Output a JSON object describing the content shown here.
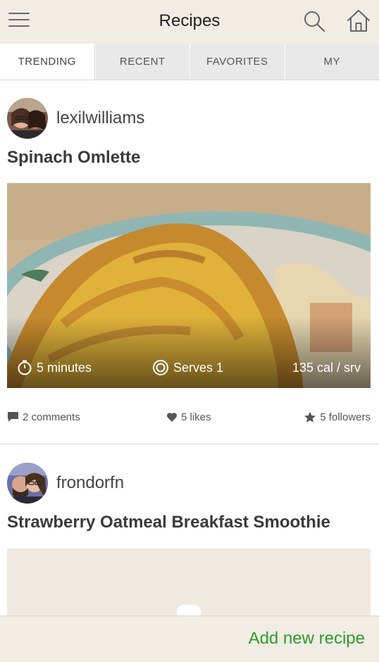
{
  "header": {
    "title": "Recipes",
    "menu_icon": "hamburger-menu-icon",
    "search_icon": "search-icon",
    "home_icon": "home-icon"
  },
  "tabs": [
    {
      "label": "TRENDING",
      "active": true
    },
    {
      "label": "RECENT",
      "active": false
    },
    {
      "label": "FAVORITES",
      "active": false
    },
    {
      "label": "MY",
      "active": false
    }
  ],
  "recipes": [
    {
      "author": "lexilwilliams",
      "title": "Spinach Omlette",
      "time": "5 minutes",
      "serves": "Serves 1",
      "calories": "135 cal / srv",
      "comments": "2 comments",
      "likes": "5 likes",
      "followers": "5 followers"
    },
    {
      "author": "frondorfn",
      "title": "Strawberry Oatmeal Breakfast Smoothie"
    }
  ],
  "footer": {
    "add_label": "Add new recipe",
    "accent": "#2e9b2e"
  },
  "colors": {
    "header_bg": "#f1ece4",
    "tab_bg": "#e9e9e9"
  }
}
